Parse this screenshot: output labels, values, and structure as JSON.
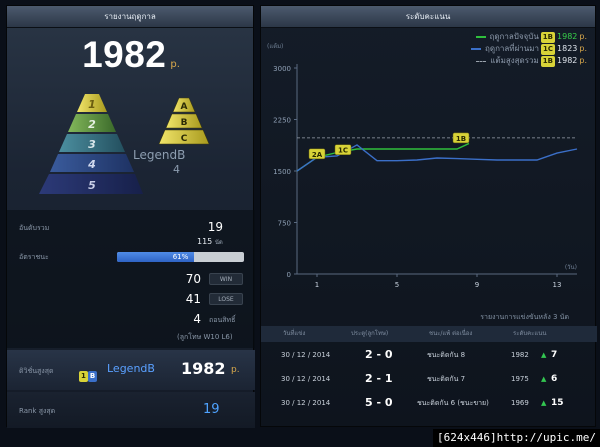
{
  "left": {
    "title": "รายงานฤดูกาล",
    "points": "1982",
    "points_unit": "p.",
    "pyramid_levels": [
      "1",
      "2",
      "3",
      "4",
      "5"
    ],
    "badge_letters": [
      "A",
      "B",
      "C"
    ],
    "tier_name": "LegendB",
    "tier_number": "4",
    "stats": {
      "total_rank_label": "อันดับรวม",
      "total_rank": "19",
      "total_players": "115",
      "total_players_unit": "นัด",
      "win_rate_label": "อัตราชนะ",
      "win_rate": 0.61,
      "win_rate_text": "61%",
      "wins": "70",
      "wins_label": "WIN",
      "losses": "41",
      "losses_label": "LOSE",
      "draws": "4",
      "draws_label": "ถอนสิทธิ์",
      "record_note": "(ลูกโทษ W10 L6)"
    },
    "best": {
      "label": "ดิวิชั่นสูงสุด",
      "badge_left": "1",
      "badge_right": "B",
      "tier": "LegendB",
      "points": "1982",
      "unit": "p."
    },
    "rank": {
      "label": "Rank สูงสุด",
      "value": "19"
    }
  },
  "right": {
    "title": "ระดับคะแนน",
    "legend": [
      {
        "name": "ฤดูกาลปัจจุบัน",
        "badge": "1B",
        "value": "1982",
        "unit": "p.",
        "color": "#2fbf3c"
      },
      {
        "name": "ฤดูกาลที่ผ่านมา",
        "badge": "1C",
        "value": "1823",
        "unit": "p.",
        "color": "#3b6fc8"
      },
      {
        "name": "แต้มสูงสุดรวม",
        "badge": "1B",
        "value": "1982",
        "unit": "p.",
        "color": "#9aa3ad"
      }
    ],
    "recent_caption": "รายงานการแข่งขันหลัง 3 นัด",
    "table_headers": [
      "วันที่แข่ง",
      "ประตู(ลูกโทษ)",
      "ชนะ/แพ้ ต่อเนื่อง",
      "ระดับคะแนน"
    ],
    "matches": [
      {
        "date": "30 / 12 / 2014",
        "score": "2 - 0",
        "streak": "ชนะติดกัน 8",
        "points": "1982",
        "delta": "7"
      },
      {
        "date": "30 / 12 / 2014",
        "score": "2 - 1",
        "streak": "ชนะติดกัน 7",
        "points": "1975",
        "delta": "6"
      },
      {
        "date": "30 / 12 / 2014",
        "score": "5 - 0",
        "streak": "ชนะติดกัน 6 (ชนะขาย)",
        "points": "1969",
        "delta": "15"
      }
    ]
  },
  "credit": "[624x446]http://upic.me/",
  "chart_data": {
    "type": "line",
    "ylabel": "(แต้ม)",
    "xlabel": "(วัน)",
    "ylim": [
      0,
      3000
    ],
    "yticks": [
      "3000",
      "2250",
      "1500",
      "750",
      "0"
    ],
    "xticks": [
      "1",
      "5",
      "9",
      "13"
    ],
    "xlim": [
      0,
      14
    ],
    "series": [
      {
        "name": "ฤดูกาลปัจจุบัน",
        "color": "#2fbf3c",
        "points": [
          [
            0,
            1500
          ],
          [
            1,
            1700
          ],
          [
            2,
            1770
          ],
          [
            3,
            1820
          ],
          [
            4,
            1820
          ],
          [
            5,
            1820
          ],
          [
            6,
            1820
          ],
          [
            7,
            1820
          ],
          [
            8,
            1820
          ],
          [
            8.6,
            1900
          ]
        ]
      },
      {
        "name": "ฤดูกาลที่ผ่านมา",
        "color": "#3b6fc8",
        "points": [
          [
            0,
            1500
          ],
          [
            1,
            1700
          ],
          [
            2,
            1720
          ],
          [
            3,
            1880
          ],
          [
            4,
            1650
          ],
          [
            5,
            1650
          ],
          [
            6,
            1660
          ],
          [
            7,
            1690
          ],
          [
            8,
            1680
          ],
          [
            9,
            1670
          ],
          [
            10,
            1660
          ],
          [
            11,
            1660
          ],
          [
            12,
            1660
          ],
          [
            13,
            1760
          ],
          [
            14,
            1820
          ]
        ]
      }
    ],
    "reference_line": 1982,
    "markers": [
      {
        "x": 1,
        "y": 1750,
        "label": "2A"
      },
      {
        "x": 2.3,
        "y": 1810,
        "label": "1C"
      },
      {
        "x": 8.2,
        "y": 1982,
        "label": "1B"
      }
    ]
  }
}
